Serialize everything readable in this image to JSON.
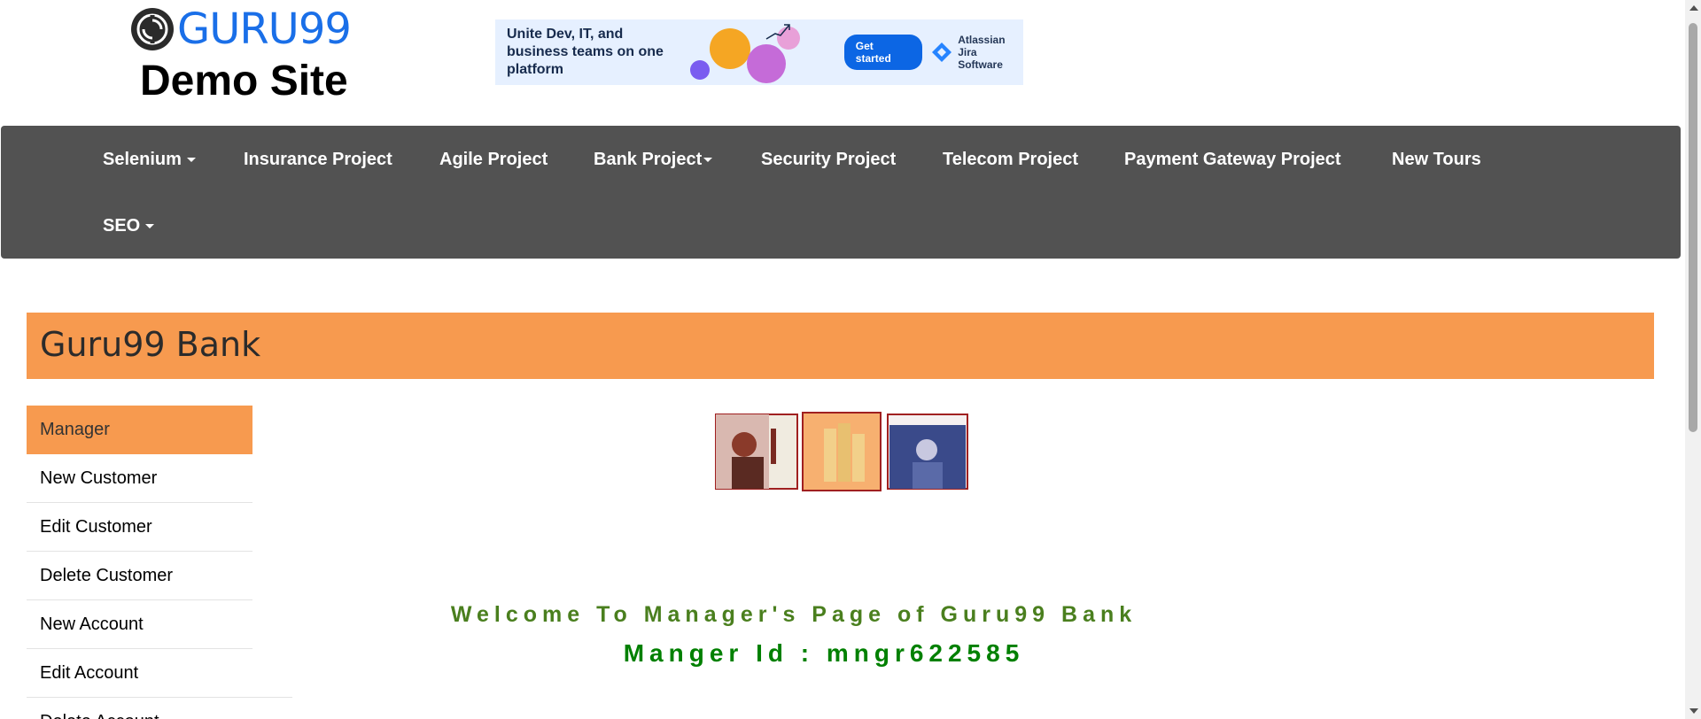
{
  "header": {
    "logo_text": "GURU99",
    "subtitle": "Demo Site"
  },
  "ad": {
    "headline": "Unite Dev, IT, and business teams on one platform",
    "cta": "Get started",
    "brand_line1": "Atlassian",
    "brand_line2": "Jira Software"
  },
  "nav": {
    "items": [
      {
        "label": "Selenium",
        "dropdown": true
      },
      {
        "label": "Insurance Project",
        "dropdown": false
      },
      {
        "label": "Agile Project",
        "dropdown": false
      },
      {
        "label": "Bank Project",
        "dropdown": true
      },
      {
        "label": "Security Project",
        "dropdown": false
      },
      {
        "label": "Telecom Project",
        "dropdown": false
      },
      {
        "label": "Payment Gateway Project",
        "dropdown": false
      },
      {
        "label": "New Tours",
        "dropdown": false
      },
      {
        "label": "SEO",
        "dropdown": true
      }
    ]
  },
  "bank": {
    "title": "Guru99 Bank"
  },
  "sidebar": {
    "items": [
      {
        "label": "Manager",
        "active": true
      },
      {
        "label": "New Customer"
      },
      {
        "label": "Edit Customer"
      },
      {
        "label": "Delete Customer"
      },
      {
        "label": "New Account"
      },
      {
        "label": "Edit Account"
      },
      {
        "label": "Delete Account"
      }
    ]
  },
  "main": {
    "welcome": "Welcome To Manager's Page of Guru99 Bank",
    "manager_id": "Manger Id : mngr622585"
  },
  "colors": {
    "brand_blue": "#1a6fe8",
    "nav_bg": "#525252",
    "accent_orange": "#f79a4f",
    "welcome_green": "#4a7f1e",
    "id_green": "#008000"
  }
}
